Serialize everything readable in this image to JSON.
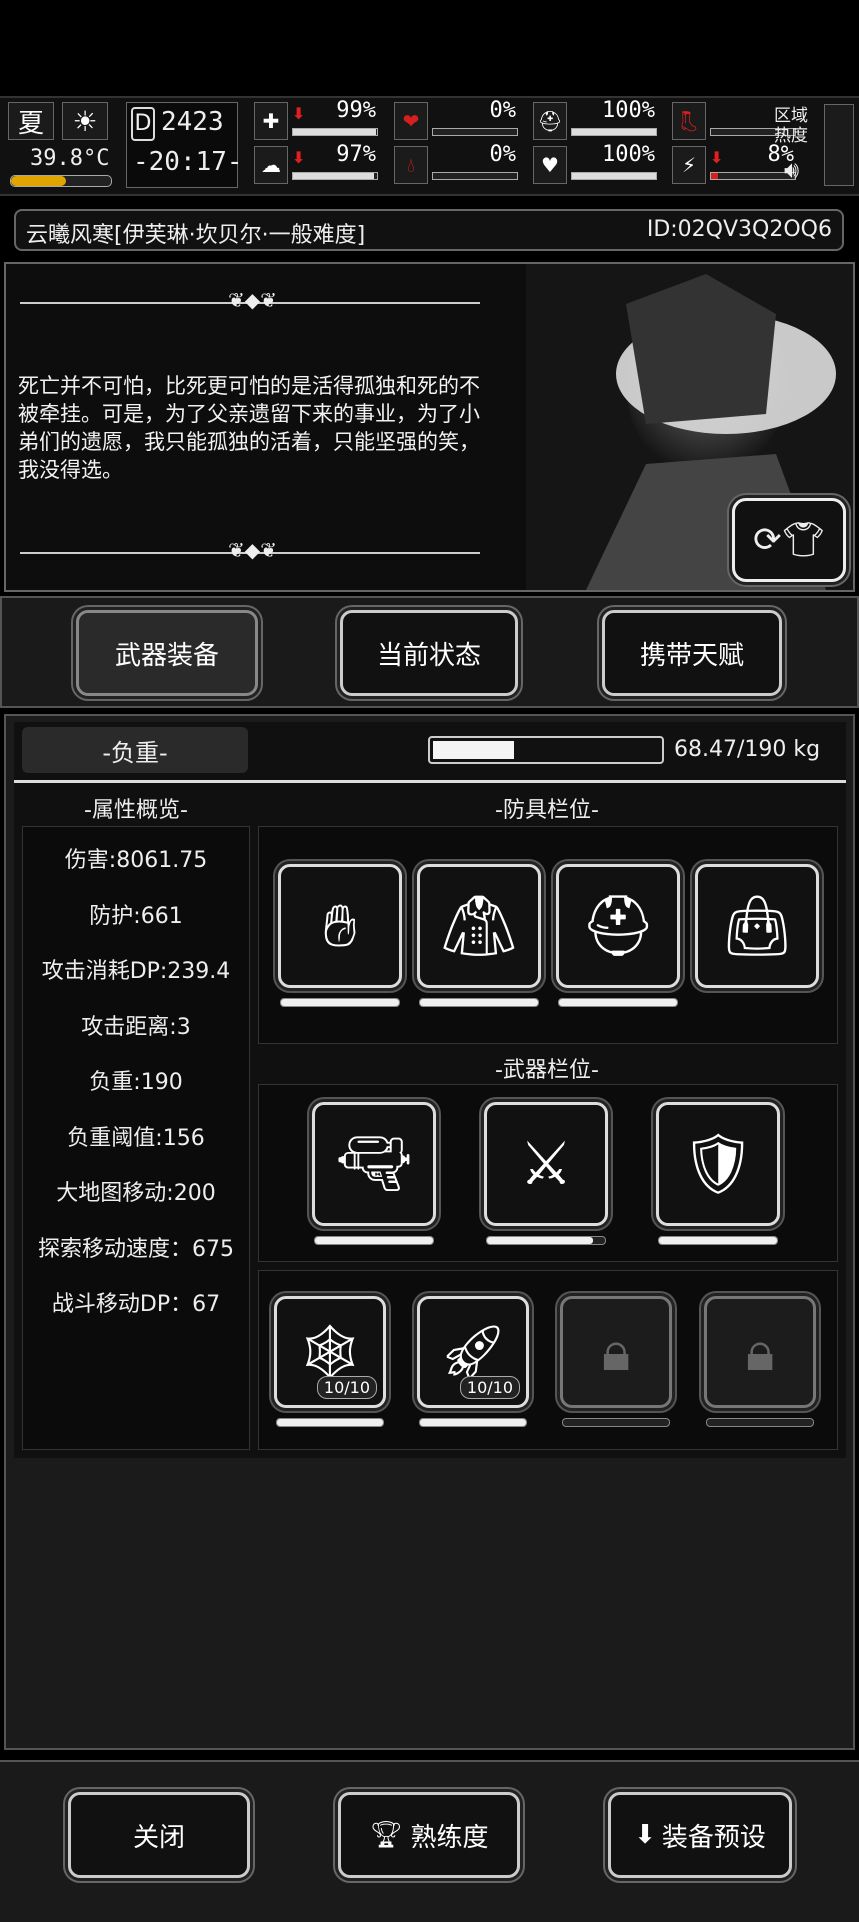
{
  "hud": {
    "season": "夏",
    "temperature": "39.8°C",
    "day_counter": "2423",
    "time_display": "-20:17-",
    "stats": [
      {
        "icon": "medkit-icon",
        "value": "99%",
        "fill": 0.99,
        "trend": "down"
      },
      {
        "icon": "stomach-icon",
        "value": "0%",
        "fill": 0,
        "trend": "none"
      },
      {
        "icon": "shield-head-icon",
        "value": "100%",
        "fill": 1.0,
        "trend": "none"
      },
      {
        "icon": "boot-icon",
        "value": "",
        "fill": 0,
        "trend": "none"
      },
      {
        "icon": "brain-icon",
        "value": "97%",
        "fill": 0.97,
        "trend": "down"
      },
      {
        "icon": "blood-drop-icon",
        "value": "0%",
        "fill": 0,
        "trend": "none"
      },
      {
        "icon": "heart-icon",
        "value": "100%",
        "fill": 1.0,
        "trend": "none"
      },
      {
        "icon": "stamina-icon",
        "value": "8%",
        "fill": 0.08,
        "trend": "down"
      }
    ],
    "zone_heat_label": "区域\n热度"
  },
  "title_bar": {
    "name": "云曦风寒[伊芙琳·坎贝尔·一般难度]",
    "id": "ID:02QV3Q2OQ6"
  },
  "story": {
    "text": "死亡并不可怕，比死更可怕的是活得孤独和死的不被牵挂。可是，为了父亲遗留下来的事业，为了小弟们的遗愿，我只能孤独的活着，只能坚强的笑，我没得选。"
  },
  "tabs": [
    {
      "label": "武器装备",
      "active": true
    },
    {
      "label": "当前状态",
      "active": false
    },
    {
      "label": "携带天赋",
      "active": false
    }
  ],
  "load": {
    "label": "-负重-",
    "value_text": "68.47/190 kg",
    "fraction": 0.36
  },
  "attributes": {
    "header": "-属性概览-",
    "items": [
      "伤害:8061.75",
      "防护:661",
      "攻击消耗DP:239.4",
      "攻击距离:3",
      "负重:190",
      "负重阈值:156",
      "大地图移动:200",
      "探索移动速度：675",
      "战斗移动DP：67"
    ]
  },
  "armor": {
    "header": "-防具栏位-",
    "slots": [
      {
        "icon": "gloves-icon",
        "durability": 1.0
      },
      {
        "icon": "hooded-cloak-icon",
        "durability": 1.0
      },
      {
        "icon": "helmet-icon",
        "durability": 1.0
      },
      {
        "icon": "duffel-bag-icon",
        "durability": null
      }
    ]
  },
  "weapons": {
    "header": "-武器栏位-",
    "slots": [
      {
        "icon": "sniper-rifle-icon",
        "durability": 1.0
      },
      {
        "icon": "katana-icon",
        "durability": 0.9
      },
      {
        "icon": "armored-shield-icon",
        "durability": 1.0
      }
    ]
  },
  "consumables": {
    "slots": [
      {
        "icon": "net-trap-icon",
        "count": "10/10",
        "durability": 1.0,
        "locked": false
      },
      {
        "icon": "rocket-icon",
        "count": "10/10",
        "durability": 1.0,
        "locked": false
      },
      {
        "icon": "lock-icon",
        "count": "",
        "durability": 0,
        "locked": true
      },
      {
        "icon": "lock-icon",
        "count": "",
        "durability": 0,
        "locked": true
      }
    ]
  },
  "footer": {
    "close_label": "关闭",
    "proficiency_label": "熟练度",
    "preset_label": "装备预设"
  }
}
